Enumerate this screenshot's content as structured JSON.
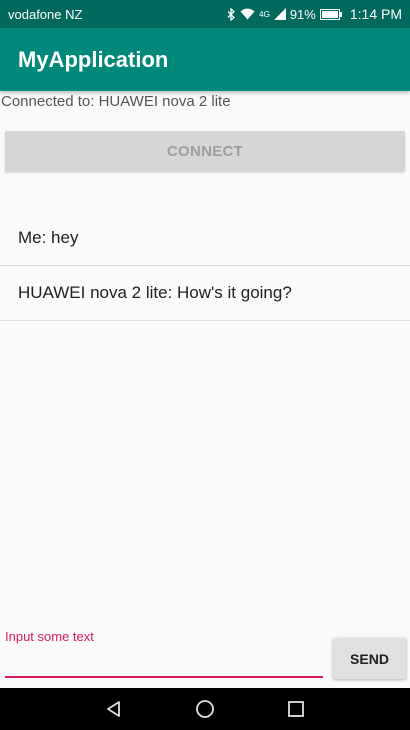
{
  "status_bar": {
    "carrier": "vodafone NZ",
    "network": "4G",
    "battery": "91%",
    "time": "1:14 PM",
    "icons": [
      "bluetooth-icon",
      "wifi-icon",
      "signal-icon",
      "battery-icon"
    ]
  },
  "app_bar": {
    "title": "MyApplication"
  },
  "connection": {
    "status_text": "Connected to: HUAWEI nova 2 lite",
    "connect_label": "CONNECT"
  },
  "messages": [
    {
      "text": "Me: hey"
    },
    {
      "text": "HUAWEI nova 2 lite:  How's it going?"
    }
  ],
  "composer": {
    "hint_label": "Input some text",
    "value": "",
    "send_label": "SEND"
  },
  "nav_bar": {
    "icons": [
      "back-icon",
      "home-icon",
      "recents-icon"
    ]
  },
  "colors": {
    "status_bar": "#00695c",
    "app_bar": "#00897b",
    "accent": "#d81b60"
  }
}
